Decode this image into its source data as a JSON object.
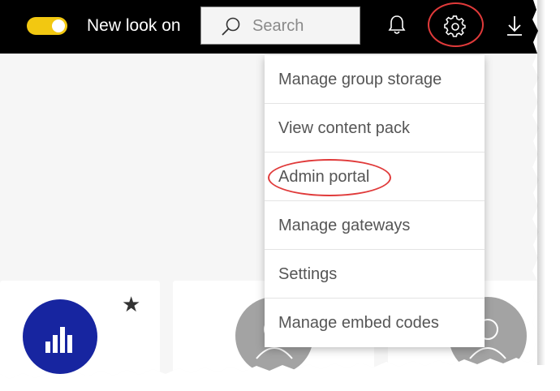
{
  "topbar": {
    "toggle_label": "New look on",
    "toggle_state": "on",
    "search_placeholder": "Search",
    "icons": [
      "notification-bell-icon",
      "settings-gear-icon",
      "download-icon"
    ]
  },
  "settings_menu": {
    "items": [
      {
        "label": "Manage group storage"
      },
      {
        "label": "View content pack"
      },
      {
        "label": "Admin portal",
        "highlighted": true
      },
      {
        "label": "Manage gateways"
      },
      {
        "label": "Settings"
      },
      {
        "label": "Manage embed codes"
      }
    ]
  },
  "cards": [
    {
      "icon": "bar-chart-icon",
      "favorite_icon": "star-icon"
    },
    {
      "icon": "user-avatar-icon"
    },
    {
      "icon": "user-avatar-icon"
    }
  ],
  "colors": {
    "topbar": "#000000",
    "toggle": "#f2c811",
    "highlight": "#e03a3a",
    "brand_circle": "#1725a0",
    "avatar": "#a3a3a3"
  }
}
